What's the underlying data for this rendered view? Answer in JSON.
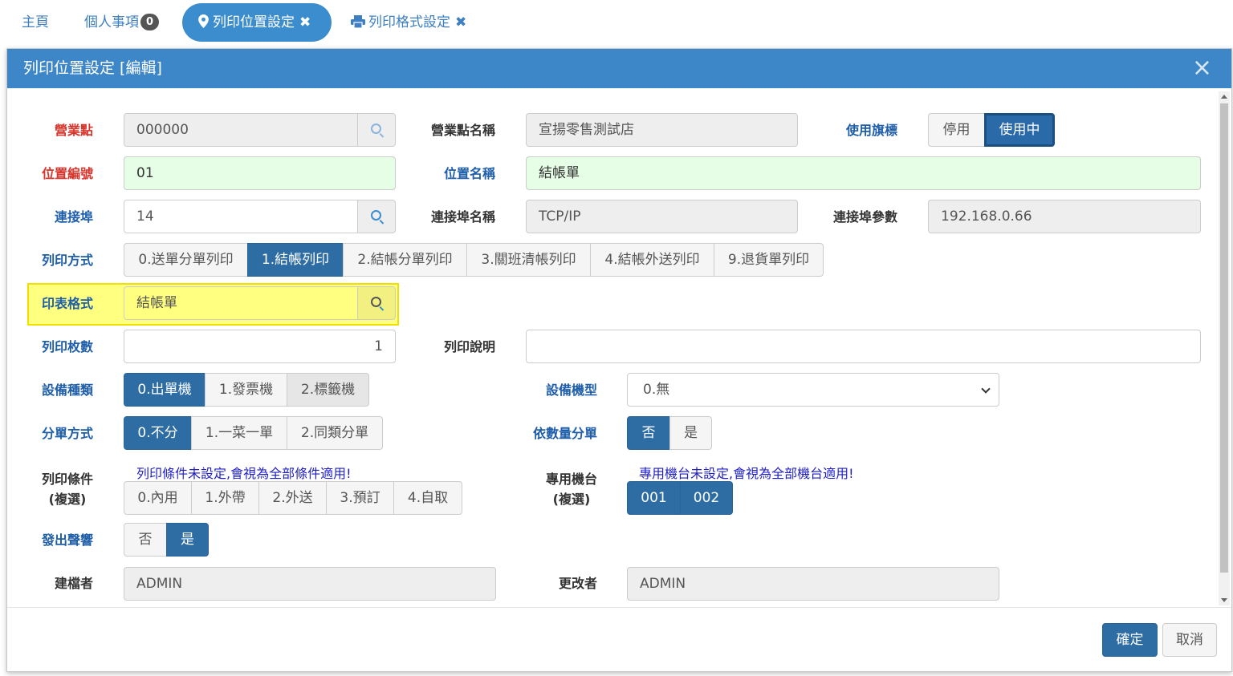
{
  "tabs": {
    "home": "主頁",
    "personal": "個人事項",
    "personal_badge": "0",
    "active": "列印位置設定",
    "format": "列印格式設定",
    "close_glyph": "✖"
  },
  "modal": {
    "title": "列印位置設定 [編輯]",
    "close": "×"
  },
  "form": {
    "store_id": {
      "label": "營業點",
      "value": "000000"
    },
    "store_name": {
      "label": "營業點名稱",
      "value": "宣揚零售測試店"
    },
    "flag": {
      "label": "使用旗標",
      "options": [
        "停用",
        "使用中"
      ],
      "selected": "使用中"
    },
    "position_no": {
      "label": "位置編號",
      "value": "01"
    },
    "position_name": {
      "label": "位置名稱",
      "value": "結帳單"
    },
    "port": {
      "label": "連接埠",
      "value": "14"
    },
    "port_name": {
      "label": "連接埠名稱",
      "value": "TCP/IP"
    },
    "port_param": {
      "label": "連接埠參數",
      "value": "192.168.0.66"
    },
    "print_mode": {
      "label": "列印方式",
      "options": [
        "0.送單分單列印",
        "1.結帳列印",
        "2.結帳分單列印",
        "3.關班清帳列印",
        "4.結帳外送列印",
        "9.退貨單列印"
      ],
      "selected": "1.結帳列印"
    },
    "format": {
      "label": "印表格式",
      "value": "結帳單"
    },
    "copies": {
      "label": "列印枚數",
      "value": "1"
    },
    "note": {
      "label": "列印說明",
      "value": ""
    },
    "device_type": {
      "label": "設備種類",
      "options": [
        "0.出單機",
        "1.發票機",
        "2.標籤機"
      ],
      "selected": "0.出單機"
    },
    "device_model": {
      "label": "設備機型",
      "value": "0.無"
    },
    "split": {
      "label": "分單方式",
      "options": [
        "0.不分",
        "1.一菜一單",
        "2.同類分單"
      ],
      "selected": "0.不分"
    },
    "qty_split": {
      "label": "依數量分單",
      "options": [
        "否",
        "是"
      ],
      "selected": "否"
    },
    "conditions": {
      "label_line1": "列印條件",
      "label_line2": "(複選)",
      "hint": "列印條件未設定,會視為全部條件適用!",
      "options": [
        "0.內用",
        "1.外帶",
        "2.外送",
        "3.預訂",
        "4.自取"
      ]
    },
    "terminals": {
      "label_line1": "專用機台",
      "label_line2": "(複選)",
      "hint": "專用機台未設定,會視為全部機台適用!",
      "options": [
        "001",
        "002"
      ]
    },
    "beep": {
      "label": "發出聲響",
      "options": [
        "否",
        "是"
      ],
      "selected": "是"
    },
    "creator": {
      "label": "建檔者",
      "value": "ADMIN"
    },
    "modifier": {
      "label": "更改者",
      "value": "ADMIN"
    }
  },
  "footer": {
    "ok": "確定",
    "cancel": "取消"
  }
}
